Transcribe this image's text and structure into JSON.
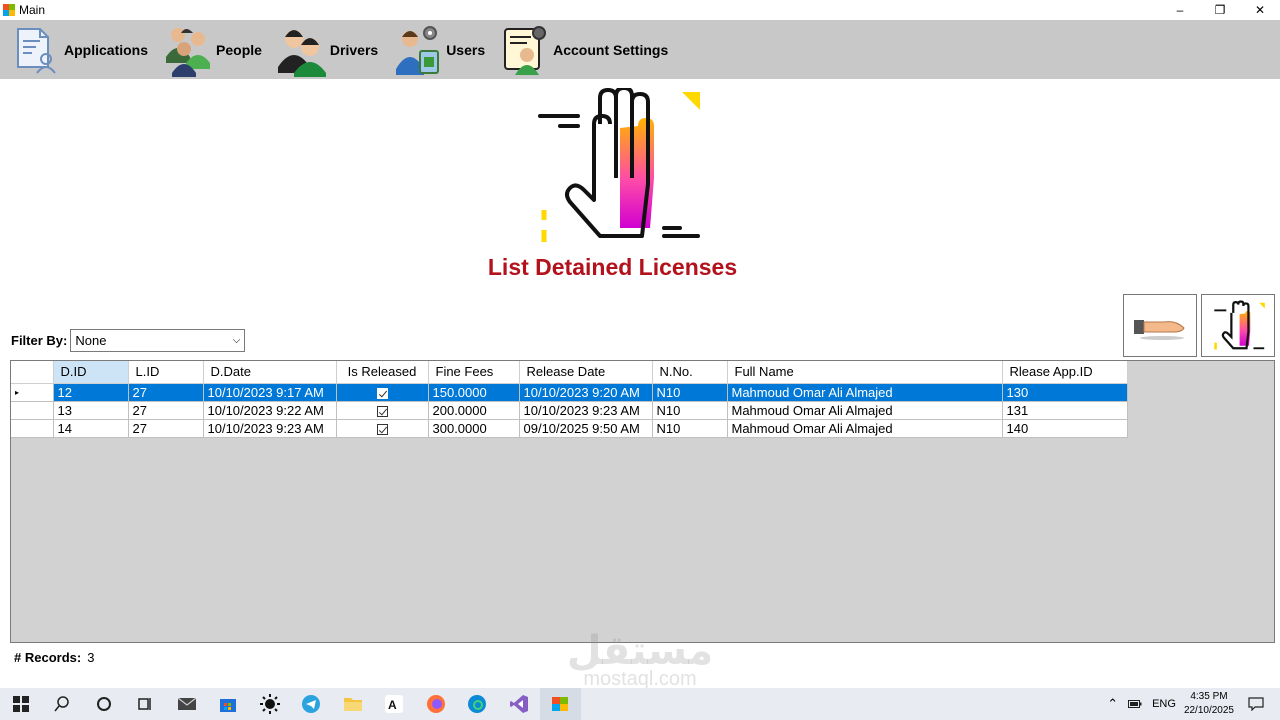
{
  "window": {
    "title": "Main"
  },
  "menu": [
    {
      "label": "Applications",
      "icon": "applications-icon"
    },
    {
      "label": "People",
      "icon": "people-icon"
    },
    {
      "label": "Drivers",
      "icon": "drivers-icon"
    },
    {
      "label": "Users",
      "icon": "users-icon"
    },
    {
      "label": "Account Settings",
      "icon": "account-settings-icon"
    }
  ],
  "page": {
    "title": "List Detained Licenses"
  },
  "filter": {
    "label": "Filter By:",
    "value": "None"
  },
  "grid": {
    "columns": [
      "D.ID",
      "L.ID",
      "D.Date",
      "Is Released",
      "Fine Fees",
      "Release Date",
      "N.No.",
      "Full Name",
      "Rlease App.ID"
    ],
    "rows": [
      {
        "d_id": "12",
        "l_id": "27",
        "d_date": "10/10/2023 9:17 AM",
        "is_released": true,
        "fine_fees": "150.0000",
        "release_date": "10/10/2023 9:20 AM",
        "n_no": "N10",
        "full_name": "Mahmoud Omar Ali Almajed",
        "release_app_id": "130"
      },
      {
        "d_id": "13",
        "l_id": "27",
        "d_date": "10/10/2023 9:22 AM",
        "is_released": true,
        "fine_fees": "200.0000",
        "release_date": "10/10/2023 9:23 AM",
        "n_no": "N10",
        "full_name": "Mahmoud Omar Ali Almajed",
        "release_app_id": "131"
      },
      {
        "d_id": "14",
        "l_id": "27",
        "d_date": "10/10/2023 9:23 AM",
        "is_released": true,
        "fine_fees": "300.0000",
        "release_date": "09/10/2025 9:50 AM",
        "n_no": "N10",
        "full_name": "Mahmoud Omar Ali Almajed",
        "release_app_id": "140"
      }
    ]
  },
  "records": {
    "label": "# Records:",
    "count": "3"
  },
  "watermark": {
    "arabic": "مستقل",
    "latin": "mostaql.com"
  },
  "taskbar": {
    "language": "ENG",
    "time": "4:35 PM",
    "date": "22/10/2025"
  },
  "colors": {
    "title_red": "#b3111c",
    "selection_blue": "#0078d7",
    "toolbar_gray": "#c8c8c8",
    "grid_bg": "#d2d2d2"
  }
}
